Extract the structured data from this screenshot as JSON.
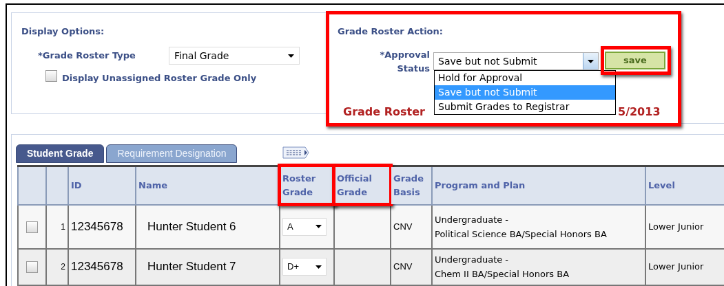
{
  "display_options": {
    "title": "Display Options:",
    "roster_type_label": "*Grade Roster Type",
    "roster_type_value": "Final Grade",
    "unassigned_only": {
      "label": "Display Unassigned Roster Grade Only",
      "checked": false
    }
  },
  "grade_roster_action": {
    "title": "Grade Roster Action:",
    "highlighted": true,
    "approval_label": "*Approval Status",
    "approval_value": "Save but not Submit",
    "expanded": true,
    "options": [
      {
        "label": "Hold for Approval",
        "selected": false
      },
      {
        "label": "Save but not Submit",
        "selected": true
      },
      {
        "label": "Submit Grades to Registrar",
        "selected": false
      }
    ],
    "save_button": {
      "label": "save",
      "highlighted": true
    },
    "status_left": "Grade Roster",
    "status_right": "5/2013"
  },
  "tabs": [
    {
      "label": "Student Grade",
      "selected": true
    },
    {
      "label": "Requirement Designation",
      "selected": false
    }
  ],
  "table": {
    "columns": [
      {
        "highlighted": false
      },
      {
        "highlighted": false
      },
      {
        "label": "ID",
        "highlighted": false
      },
      {
        "label": "Name",
        "highlighted": false
      },
      {
        "label": "Roster Grade",
        "highlighted": true
      },
      {
        "label": "Official Grade",
        "highlighted": true
      },
      {
        "label": "Grade Basis",
        "highlighted": false
      },
      {
        "label": "Program and Plan",
        "highlighted": false
      },
      {
        "label": "Level",
        "highlighted": false
      }
    ],
    "rows": [
      {
        "checked": false,
        "number": "1",
        "id": "12345678",
        "name": "Hunter Student 6",
        "roster_grade": "A",
        "grade_basis": "CNV",
        "program_and_plan": "Undergraduate -\nPolitical Science BA/Special Honors BA",
        "level": "Lower Junior"
      },
      {
        "checked": false,
        "number": "2",
        "id": "12345678",
        "name": "Hunter Student 7",
        "roster_grade": "D+",
        "grade_basis": "CNV",
        "program_and_plan": "Undergraduate -\nChem II BA/Special Honors BA",
        "level": "Lower Junior"
      }
    ]
  }
}
